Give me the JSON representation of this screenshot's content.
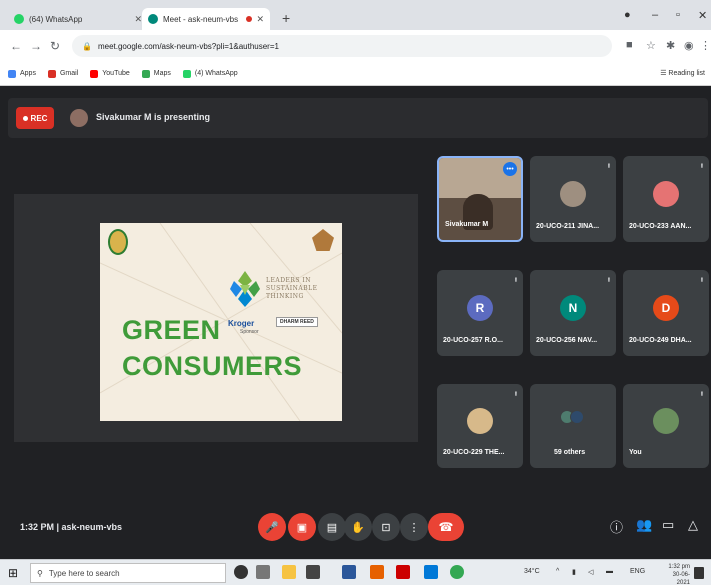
{
  "browser": {
    "tabs": [
      {
        "title": "(64) WhatsApp",
        "active": false,
        "favicon_color": "#25d366"
      },
      {
        "title": "Meet - ask-neum-vbs",
        "active": true,
        "favicon_color": "#00897b"
      }
    ],
    "new_tab_label": "+",
    "url": "meet.google.com/ask-neum-vbs?pli=1&authuser=1",
    "bookmarks": [
      {
        "label": "Apps",
        "color": "#4285f4"
      },
      {
        "label": "Gmail",
        "color": "#d93025"
      },
      {
        "label": "YouTube",
        "color": "#ff0000"
      },
      {
        "label": "Maps",
        "color": "#34a853"
      },
      {
        "label": "(4) WhatsApp",
        "color": "#25d366"
      }
    ],
    "reading_list_label": "Reading list"
  },
  "meet": {
    "rec_label": "REC",
    "presenting_text": "Sivakumar M is presenting",
    "slide": {
      "leaders_text": "LEADERS IN SUSTAINABLE THINKING",
      "kroger_label": "Kroger",
      "kroger_sub": "Sponsor",
      "dharm_label": "DHARM REED",
      "title_line1": "GREEN",
      "title_line2": "CONSUMERS",
      "title_color": "#3f9b39"
    },
    "tiles": [
      {
        "name": "Sivakumar M",
        "type": "camera",
        "mic": ""
      },
      {
        "name": "20-UCO-211 JINA...",
        "type": "photo",
        "mic": "Ꞌ",
        "photo_color": "#9e8f80"
      },
      {
        "name": "20-UCO-233 AAN...",
        "type": "photo",
        "mic": "Ꞌ",
        "photo_color": "#e57373"
      },
      {
        "name": "20-UCO-257 R.O...",
        "type": "letter",
        "mic": "Ꞌ",
        "letter": "R",
        "color": "#5c6bc0"
      },
      {
        "name": "20-UCO-256 NAV...",
        "type": "letter",
        "mic": "Ꞌ",
        "letter": "N",
        "color": "#00897b"
      },
      {
        "name": "20-UCO-249 DHA...",
        "type": "letter",
        "mic": "Ꞌ",
        "letter": "D",
        "color": "#e64a19"
      },
      {
        "name": "20-UCO-229 THE...",
        "type": "photo",
        "mic": "Ꞌ",
        "photo_color": "#d7b98a"
      },
      {
        "name": "59 others",
        "type": "others",
        "mic": ""
      },
      {
        "name": "You",
        "type": "photo",
        "mic": "Ꞌ",
        "photo_color": "#6b8f5e"
      }
    ],
    "time_label": "1:32 PM  |  ask-neum-vbs"
  },
  "taskbar": {
    "search_placeholder": "Type here to search",
    "weather": "34°C",
    "lang": "ENG",
    "time": "1:32 pm",
    "date": "30-06-2021"
  }
}
